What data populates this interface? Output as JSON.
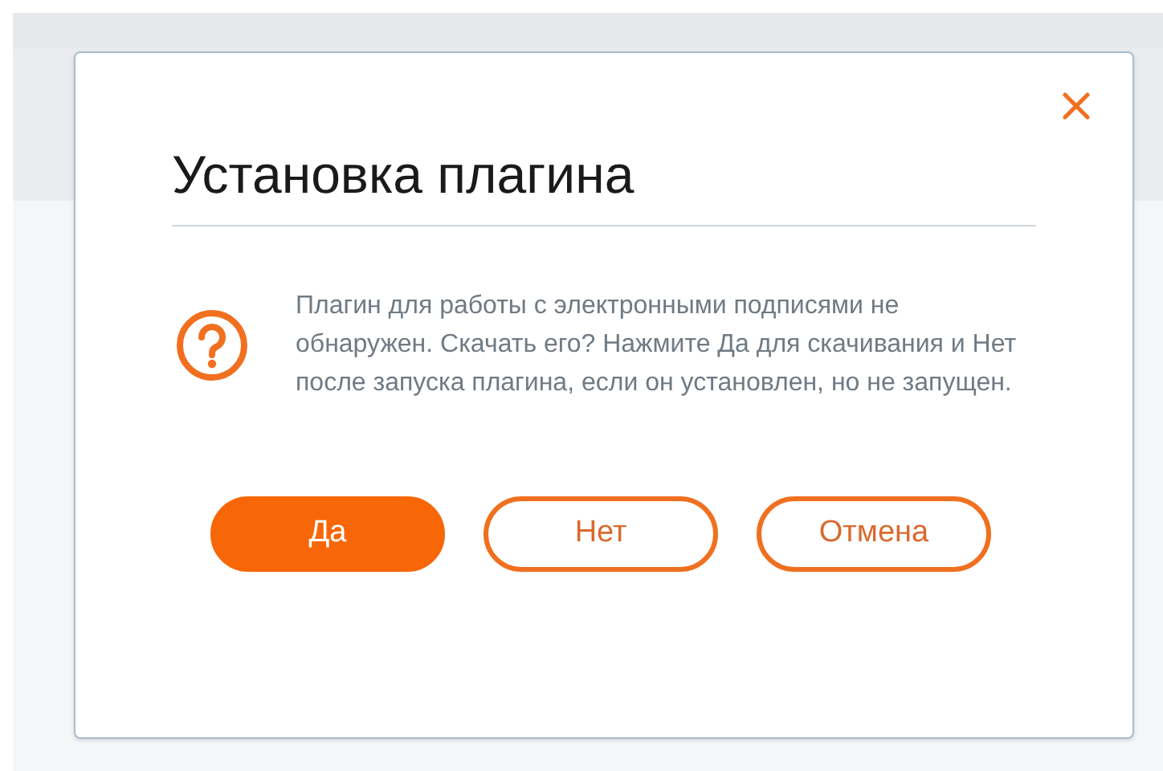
{
  "dialog": {
    "title": "Установка плагина",
    "message": "Плагин для работы с электронными подписями не обнаружен. Скачать его? Нажмите Да для скачивания и Нет после запуска плагина, если он установлен, но не запущен.",
    "buttons": [
      {
        "label": "Да",
        "kind": "primary"
      },
      {
        "label": "Нет",
        "kind": "secondary"
      },
      {
        "label": "Отмена",
        "kind": "secondary"
      }
    ]
  }
}
